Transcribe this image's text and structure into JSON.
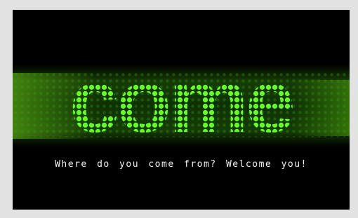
{
  "banner": {
    "logo_word": "come",
    "logo_style": "green halftone dot lettering",
    "accent_color": "#66ff22",
    "glow_color": "#2f7a0c",
    "background_color": "#000000"
  },
  "tagline": {
    "text": "Where do you come from? Welcome you!"
  }
}
